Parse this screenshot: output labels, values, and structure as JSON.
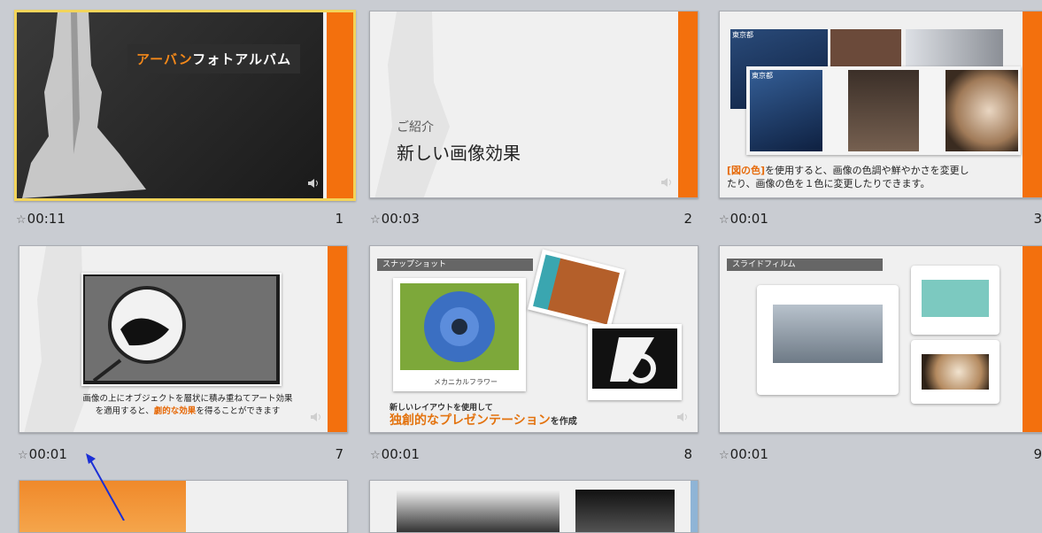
{
  "slides": [
    {
      "time": "00:11",
      "number": "1",
      "title_accent": "アーバン",
      "title_rest": "フォトアルバム"
    },
    {
      "time": "00:03",
      "number": "2",
      "subtitle": "ご紹介",
      "title": "新しい画像効果"
    },
    {
      "time": "00:01",
      "number": "3",
      "caption_highlight": "[図の色]",
      "caption_line1": "を使用すると、画像の色調や鮮やかさを変更し",
      "caption_line2": "たり、画像の色を１色に変更したりできます。",
      "tag1": "東京都",
      "tag2": "東京都"
    },
    {
      "time": "00:01",
      "number": "7",
      "caption_line1": "画像の上にオブジェクトを層状に積み重ねてアート効果",
      "caption_line2a": "を適用すると、",
      "caption_highlight": "劇的な効果",
      "caption_line2b": "を得ることができます"
    },
    {
      "time": "00:01",
      "number": "8",
      "label": "スナップショット",
      "photo_caption": "メカニカルフラワー",
      "line1": "新しいレイアウトを使用して",
      "highlight": "独創的なプレゼンテーション",
      "suffix": "を作成"
    },
    {
      "time": "00:01",
      "number": "9",
      "label": "スライドフィルム"
    }
  ],
  "colors": {
    "accent": "#f3700d",
    "selection": "#f2d45a",
    "background": "#c9ccd2",
    "arrow": "#1b2fd6"
  },
  "icons": {
    "star": "☆",
    "sound": "speaker-icon"
  }
}
